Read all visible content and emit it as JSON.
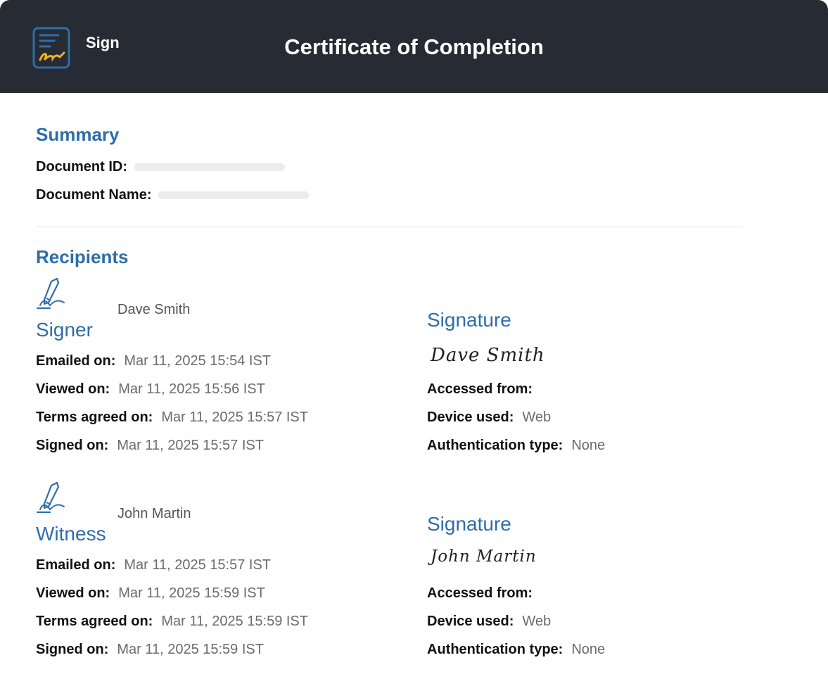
{
  "header": {
    "brand": "Sign",
    "title": "Certificate of Completion",
    "icon": "sign-logo-icon"
  },
  "summary": {
    "title": "Summary",
    "document_id_label": "Document ID:",
    "document_name_label": "Document Name:"
  },
  "recipients": {
    "title": "Recipients",
    "items": [
      {
        "role": "Signer",
        "name": "Dave Smith",
        "role_icon": "pen-signing-icon",
        "emailed_label": "Emailed on:",
        "emailed": "Mar 11, 2025 15:54 IST",
        "viewed_label": "Viewed on:",
        "viewed": "Mar 11, 2025 15:56 IST",
        "terms_label": "Terms agreed on:",
        "terms": "Mar 11, 2025 15:57 IST",
        "signed_label": "Signed on:",
        "signed": "Mar 11, 2025 15:57 IST",
        "signature_title": "Signature",
        "signature_text": "Dave Smith",
        "accessed_label": "Accessed from:",
        "device_label": "Device used:",
        "device": "Web",
        "auth_label": "Authentication type:",
        "auth": "None"
      },
      {
        "role": "Witness",
        "name": "John Martin",
        "role_icon": "pen-signing-icon",
        "emailed_label": "Emailed on:",
        "emailed": "Mar 11, 2025 15:57 IST",
        "viewed_label": "Viewed on:",
        "viewed": "Mar 11, 2025 15:59 IST",
        "terms_label": "Terms agreed on:",
        "terms": "Mar 11, 2025 15:59 IST",
        "signed_label": "Signed on:",
        "signed": "Mar 11, 2025 15:59 IST",
        "signature_title": "Signature",
        "signature_text": "John Martin",
        "accessed_label": "Accessed from:",
        "device_label": "Device used:",
        "device": "Web",
        "auth_label": "Authentication type:",
        "auth": "None"
      }
    ]
  },
  "colors": {
    "header_bg": "#262b34",
    "accent_blue": "#2f6da8",
    "logo_yellow": "#f0b323"
  }
}
